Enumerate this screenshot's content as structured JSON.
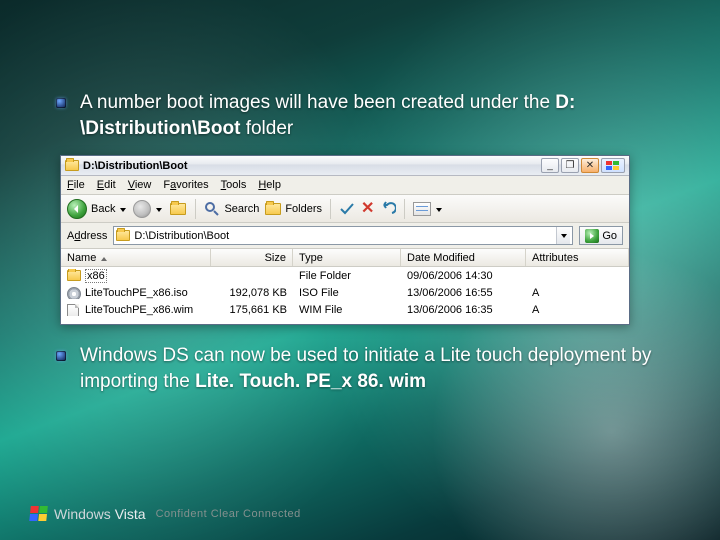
{
  "slide": {
    "bullets": [
      {
        "prefix": "A number boot images will have been created under the ",
        "bold": "D: \\Distribution\\Boot",
        "suffix": " folder"
      },
      {
        "prefix": "Windows DS can now be used to initiate a Lite touch deployment by importing the ",
        "bold": "Lite. Touch. PE_x 86. wim",
        "suffix": ""
      }
    ]
  },
  "explorer": {
    "title": "D:\\Distribution\\Boot",
    "menus": {
      "file": "File",
      "edit": "Edit",
      "view": "View",
      "favorites": "Favorites",
      "tools": "Tools",
      "help": "Help",
      "underline": {
        "file": "F",
        "edit": "E",
        "view": "V",
        "favorites": "a",
        "tools": "T",
        "help": "H"
      }
    },
    "toolbar": {
      "back": "Back",
      "search": "Search",
      "folders": "Folders"
    },
    "address": {
      "label": "Address",
      "value": "D:\\Distribution\\Boot",
      "go": "Go"
    },
    "columns": {
      "name": "Name",
      "size": "Size",
      "type": "Type",
      "date": "Date Modified",
      "attr": "Attributes"
    },
    "rows": [
      {
        "icon": "folder",
        "name": "x86",
        "size": "",
        "type": "File Folder",
        "date": "09/06/2006 14:30",
        "attr": ""
      },
      {
        "icon": "iso",
        "name": "LiteTouchPE_x86.iso",
        "size": "192,078 KB",
        "type": "ISO File",
        "date": "13/06/2006 16:55",
        "attr": "A"
      },
      {
        "icon": "file",
        "name": "LiteTouchPE_x86.wim",
        "size": "175,661 KB",
        "type": "WIM File",
        "date": "13/06/2006 16:35",
        "attr": "A"
      }
    ],
    "winbuttons": {
      "min": "_",
      "max": "❐",
      "close": "✕"
    }
  },
  "footer": {
    "brand_prefix": "Windows",
    "brand_suffix": "Vista",
    "tagline": "Confident   Clear   Connected"
  }
}
